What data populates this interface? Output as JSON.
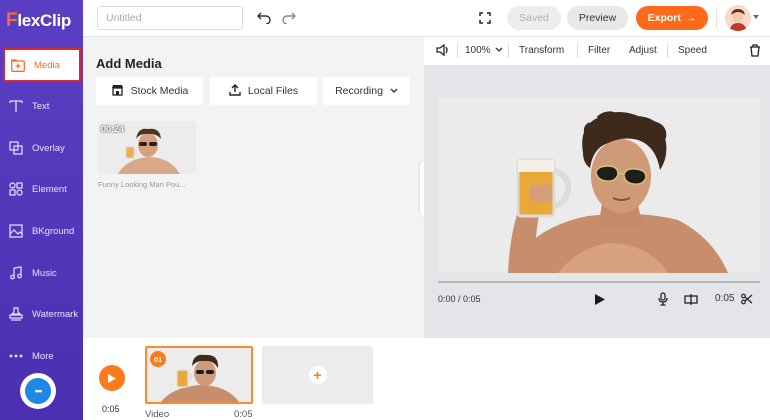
{
  "app": {
    "logo_text": "lexClip",
    "logo_letter": "F"
  },
  "sidebar": {
    "items": [
      {
        "label": "Media",
        "icon": "media-icon",
        "active": true
      },
      {
        "label": "Text",
        "icon": "text-icon"
      },
      {
        "label": "Overlay",
        "icon": "overlay-icon"
      },
      {
        "label": "Element",
        "icon": "element-icon"
      },
      {
        "label": "BKground",
        "icon": "background-icon"
      },
      {
        "label": "Music",
        "icon": "music-icon"
      },
      {
        "label": "Watermark",
        "icon": "watermark-icon"
      },
      {
        "label": "More",
        "icon": "more-icon"
      }
    ],
    "chat_icon": "chat-icon",
    "chat_glyph": "•••"
  },
  "topbar": {
    "title_placeholder": "Untitled",
    "undo_icon": "undo-icon",
    "redo_icon": "redo-icon",
    "fullscreen_icon": "fullscreen-icon",
    "saved_label": "Saved",
    "preview_label": "Preview",
    "export_label": "Export",
    "export_arrow": "→"
  },
  "media_panel": {
    "title": "Add Media",
    "buttons": {
      "stock": "Stock Media",
      "local": "Local Files",
      "recording": "Recording"
    },
    "items": [
      {
        "duration": "00:24",
        "caption": "Funny Looking Man Pou..."
      }
    ],
    "collapse_glyph": "‹"
  },
  "preview": {
    "volume_icon": "volume-icon",
    "zoom": "100%",
    "tools": [
      "Transform",
      "Filter",
      "Adjust",
      "Speed"
    ],
    "delete_icon": "trash-icon",
    "time_current": "0:00 / 0:05",
    "time_end": "0:05",
    "controls": [
      "play-icon",
      "microphone-icon",
      "split-icon",
      "scissors-icon"
    ]
  },
  "timeline": {
    "total_duration": "0:05",
    "clips": [
      {
        "index": "01",
        "label": "Video",
        "duration": "0:05"
      }
    ],
    "add_glyph": "+"
  },
  "colors": {
    "sidebar": "#5a3fc4",
    "accent": "#ff6a1a",
    "active_border": "#d9262b",
    "chat": "#1e88e5"
  }
}
